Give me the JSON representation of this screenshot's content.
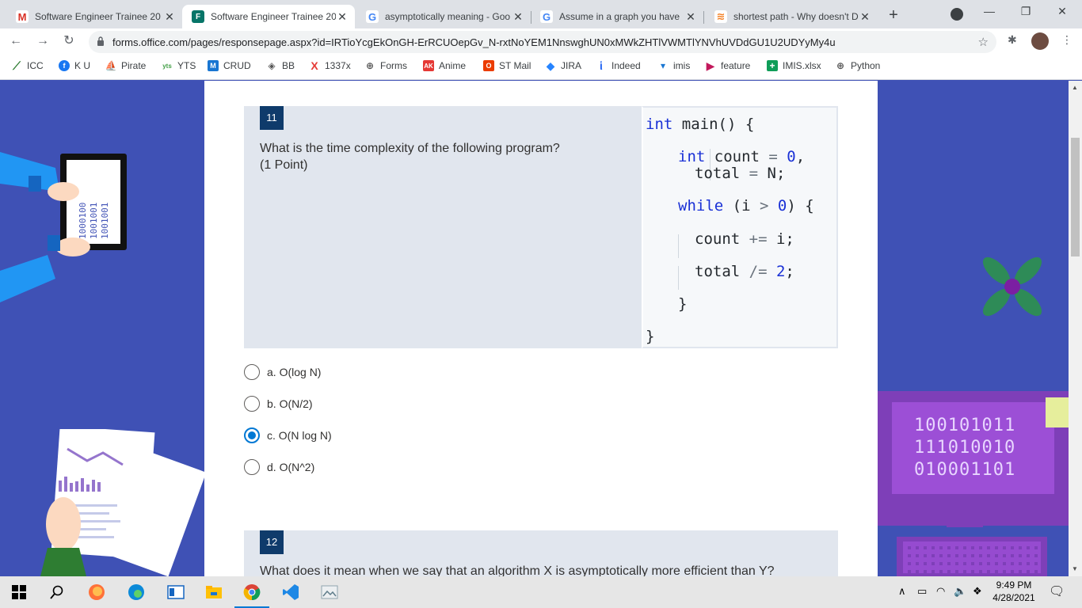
{
  "browser": {
    "tabs": [
      {
        "title": "Software Engineer Trainee 20",
        "icon": "gmail-icon"
      },
      {
        "title": "Software Engineer Trainee 20",
        "icon": "forms-icon",
        "active": true
      },
      {
        "title": "asymptotically meaning - Goo",
        "icon": "google-icon"
      },
      {
        "title": "Assume in a graph you have",
        "icon": "google-icon"
      },
      {
        "title": "shortest path - Why doesn't D",
        "icon": "stackoverflow-icon"
      }
    ],
    "url": "forms.office.com/pages/responsepage.aspx?id=IRTioYcgEkOnGH-ErRCUOepGv_N-rxtNoYEM1NnswghUN0xMWkZHTlVWMTlYNVhUVDdGU1U2UDYyMy4u"
  },
  "bookmarks": [
    {
      "label": "ICC"
    },
    {
      "label": "K U"
    },
    {
      "label": "Pirate"
    },
    {
      "label": "YTS"
    },
    {
      "label": "CRUD"
    },
    {
      "label": "BB"
    },
    {
      "label": "1337x"
    },
    {
      "label": "Forms"
    },
    {
      "label": "Anime"
    },
    {
      "label": "ST Mail"
    },
    {
      "label": "JIRA"
    },
    {
      "label": "Indeed"
    },
    {
      "label": "imis"
    },
    {
      "label": "feature"
    },
    {
      "label": "IMIS.xlsx"
    },
    {
      "label": "Python"
    }
  ],
  "question11": {
    "number": "11",
    "text": "What is the time complexity of the following program?",
    "points": "(1 Point)",
    "code": {
      "l1_kw": "int",
      "l1_rest": " main() {",
      "l2_kw": "int",
      "l2_rest": " count ",
      "l2_op": "=",
      "l2_num": " 0",
      "l2_end": ",",
      "l3": "total ",
      "l3_op": "=",
      "l3_end": " N;",
      "l4_kw": "while",
      "l4_a": " (i ",
      "l4_op": ">",
      "l4_num": " 0",
      "l4_end": ") {",
      "l5": "count ",
      "l5_op": "+=",
      "l5_end": " i;",
      "l6": "total ",
      "l6_op": "/=",
      "l6_num": " 2",
      "l6_end": ";",
      "l7": "}",
      "l8": "}"
    },
    "options": [
      {
        "label": "a. O(log N)",
        "checked": false
      },
      {
        "label": "b. O(N/2)",
        "checked": false
      },
      {
        "label": "c. O(N log N)",
        "checked": true
      },
      {
        "label": "d. O(N^2)",
        "checked": false
      }
    ]
  },
  "question12": {
    "number": "12",
    "text": "What does it mean when we say that an algorithm X is asymptotically more efficient than Y?"
  },
  "decor": {
    "binary_lines": [
      "100101011",
      "111010010",
      "010001101"
    ],
    "tablet_binary": [
      "1000100",
      "1001001",
      "1001001"
    ]
  },
  "taskbar": {
    "time": "9:49 PM",
    "date": "4/28/2021"
  }
}
